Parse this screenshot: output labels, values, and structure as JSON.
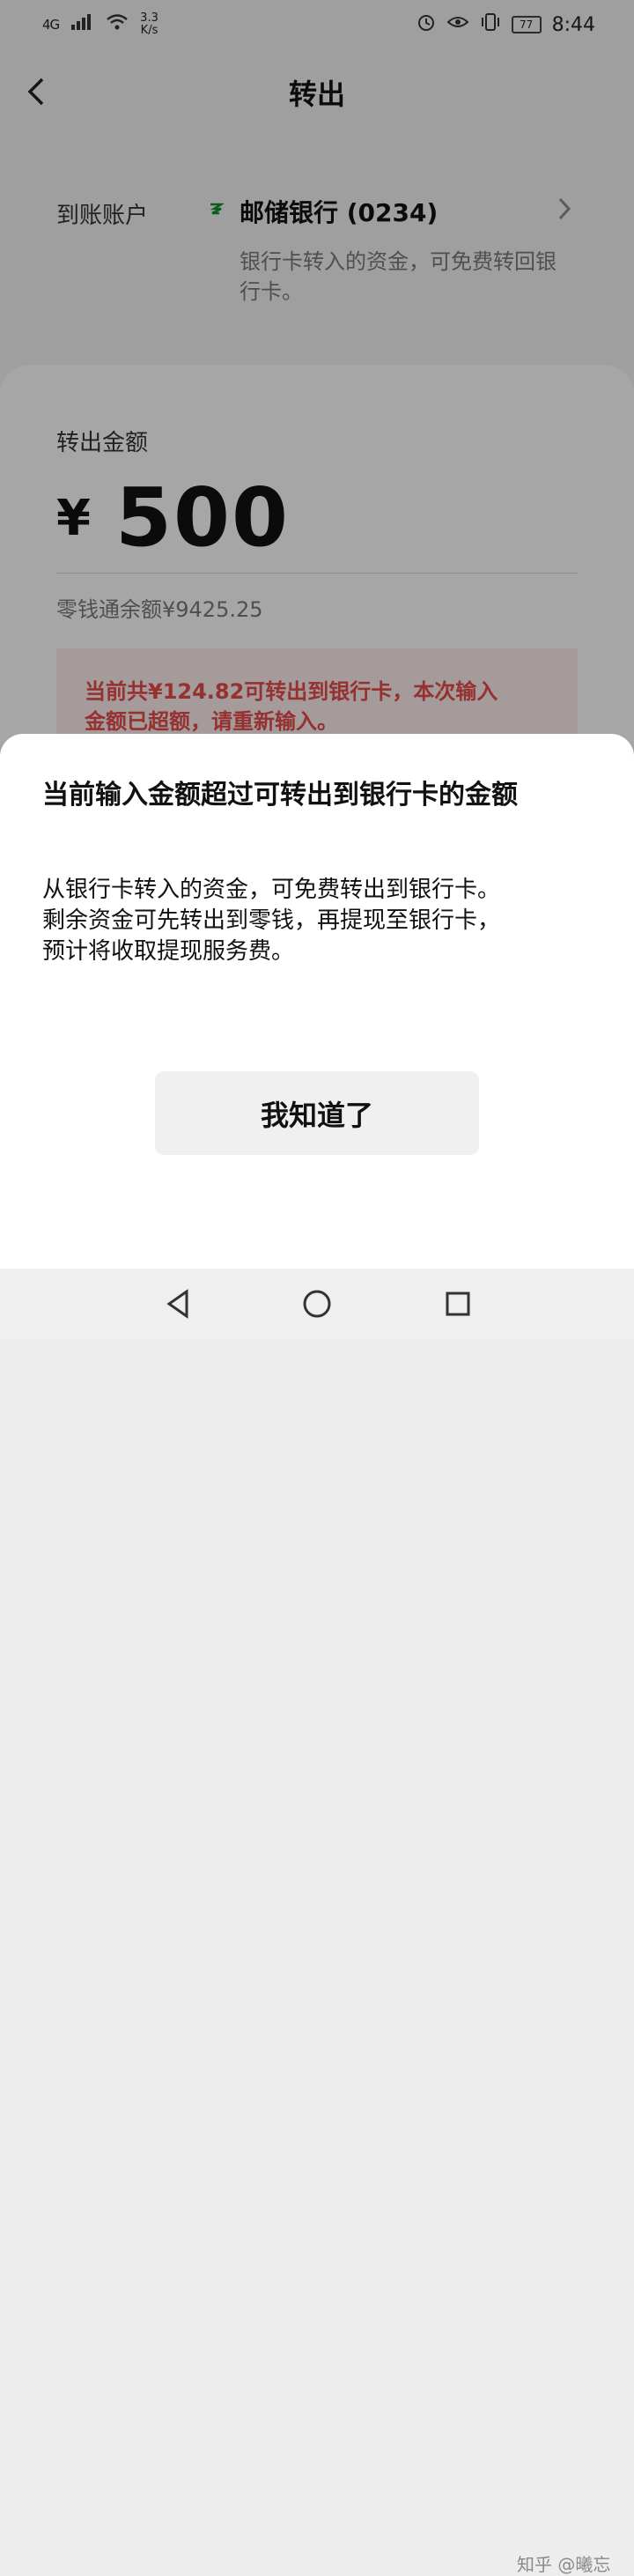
{
  "status_bar": {
    "network": "4G",
    "speed_value": "3.3",
    "speed_unit": "K/s",
    "battery": "77",
    "time": "8:44"
  },
  "header": {
    "title": "转出"
  },
  "account": {
    "label": "到账账户",
    "bank_name": "邮储银行 (0234)",
    "note": "银行卡转入的资金，可免费转回银行卡。"
  },
  "amount": {
    "label": "转出金额",
    "currency": "¥",
    "value": "500",
    "balance": "零钱通余额¥9425.25",
    "warning_line1": "当前共¥124.82可转出到银行卡，本次输入",
    "warning_line2": "金额已超额，请重新输入。"
  },
  "dialog": {
    "title": "当前输入金额超过可转出到银行卡的金额",
    "line1": "从银行卡转入的资金，可免费转出到银行卡。",
    "line2": "剩余资金可先转出到零钱，再提现至银行卡，",
    "line3": "预计将收取提现服务费。",
    "button": "我知道了"
  },
  "watermark": "知乎 @曦忘",
  "icons": {
    "signal": "signal-icon",
    "wifi": "wifi-icon",
    "alarm": "alarm-icon",
    "eye": "eye-icon",
    "vibrate": "vibrate-icon",
    "back": "back-icon",
    "bank": "bank-logo-icon",
    "chevron": "chevron-right-icon",
    "nav_back": "nav-back-icon",
    "nav_home": "nav-home-icon",
    "nav_recent": "nav-recent-icon"
  }
}
